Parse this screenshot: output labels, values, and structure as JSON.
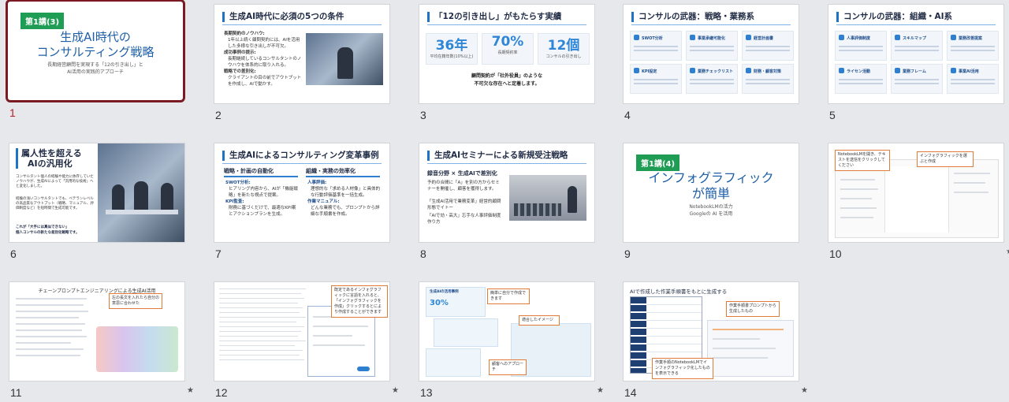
{
  "slides": [
    {
      "number": "1",
      "tag": "第1講(3)",
      "title_line1": "生成AI時代の",
      "title_line2": "コンサルティング戦略",
      "sub_line1": "長期経営顧問を実現する「12の引き出し」と",
      "sub_line2": "AI活用の実践的アプローチ"
    },
    {
      "number": "2",
      "header": "生成AI時代に必須の5つの条件",
      "items": [
        {
          "head": "長期契約のノウハウ:",
          "body": "1年以上続く顧問契約には、AIを活用した多様な引き出しが不可欠。"
        },
        {
          "head": "成功事例の提示:",
          "body": "長期継続しているコンサルタントのノウハウを体系的に取り入れる。"
        },
        {
          "head": "戦略での差別化:",
          "body": "クライアントの目の前でアウトプットを作成し、AIで動かす。"
        }
      ]
    },
    {
      "number": "3",
      "header": "「12の引き出し」がもたらす実績",
      "stats": [
        {
          "value": "36年",
          "label": "平均在籍年数(10%以上)"
        },
        {
          "value": "70%",
          "label": "長期契約率"
        },
        {
          "value": "12個",
          "label": "コンサルの引き出し"
        }
      ],
      "note_line1": "顧問契約が「社外役員」のような",
      "note_line2": "不可欠な存在へと定着します。"
    },
    {
      "number": "4",
      "header": "コンサルの武器：戦略・業務系",
      "cards": [
        "SWOT分析",
        "事業承継可能化",
        "経営計画書",
        "KPI設定",
        "業務チェックリスト",
        "財務・顧客対策"
      ]
    },
    {
      "number": "5",
      "header": "コンサルの武器：組織・AI系",
      "cards": [
        "人事評価制度",
        "スキルマップ",
        "業務改善提案",
        "ライセン活動",
        "業務フレーム",
        "事業AI活用"
      ]
    },
    {
      "number": "6",
      "title_line1": "属人性を超える",
      "title_line2": "AIの汎用化",
      "body_lines": [
        "コンサルタント個人の経験や能力に依存していたノウハウが、生成AIによって「汎用的な技術」へと変化しました。",
        "経験の浅いコンサルタントでも、ベテランレベルの高品質なアウトプット（戦略、マニュアル、評価制度など）を短時間で生成可能です。"
      ],
      "highlight_1": "これが「大手には真似できない」",
      "highlight_2": "個人コンサルの新たな差別化戦略です。"
    },
    {
      "number": "7",
      "header": "生成AIによるコンサルティング変革事例",
      "col1_title": "戦略・計画の自動化",
      "col2_title": "組織・実務の効率化",
      "col1_items": [
        {
          "head": "SWOT分析:",
          "body": "ヒアリング内容から、AIが「機能戦略」を新たな視点で提案。"
        },
        {
          "head": "KPI監査:",
          "body": "財務に基づくだけで、最適なKPI案とアクションプランを生成。"
        }
      ],
      "col2_items": [
        {
          "head": "人事評価:",
          "body": "理想的な「求める人材像」と具体的な行動評価基準を一括生成。"
        },
        {
          "head": "作業マニュアル:",
          "body": "どんな業務でも、プロンプトから詳細な手順書を作成。"
        }
      ]
    },
    {
      "number": "8",
      "header": "生成AIセミナーによる新規受注戦略",
      "subhead": "録音分野 × 生成AIで差別化",
      "body": "予約の合間に「A」を別の方からセミナーを開催し、顧客を獲得します。",
      "bullets": [
        "「生成AI活用で業務変革」経営的顧問形態でイトー",
        "「AIで効・高大」忘手な人事評価制度作り方"
      ]
    },
    {
      "number": "9",
      "tag": "第1講(4)",
      "title_line1": "インフォグラフィック",
      "title_line2": "が簡単",
      "sub_line1": "NotebookLMの活力",
      "sub_line2": "Googleの AI を活用"
    },
    {
      "number": "10",
      "callout1": "NotebookLMを開き、テキストを送信をクリックしてください",
      "callout2": "インフォグラフィックを選ぶと作成"
    },
    {
      "number": "11",
      "header": "チェーンプロンプトエンジニアリングによる生成AI活用",
      "callout": "左の長文を入れたら自分の意思に合わせた"
    },
    {
      "number": "12",
      "callout": "既定であるインフォグラフィックに言語を入れると、「インフォグラフィックを作成」クリックするとにより作成することができます"
    },
    {
      "number": "13",
      "header": "生成AIの活用事例",
      "callouts": [
        "簡単に自分で作成できます",
        "適合したイメージ",
        "顧客へのアプローチ"
      ]
    },
    {
      "number": "14",
      "header": "AIで作成した作業手順書をもとに生成する",
      "callouts": [
        "作業手順書プロンプトから生成したもの",
        "作業手順のNotebookLMでインフォグラフィック化したものを表示できる"
      ]
    }
  ],
  "starred": [
    "10",
    "11",
    "12",
    "13",
    "14"
  ],
  "star_glyph": "★",
  "colors": {
    "accent": "#1d74c7",
    "selected_border": "#7b1a22",
    "tag_green": "#1f9d55"
  }
}
